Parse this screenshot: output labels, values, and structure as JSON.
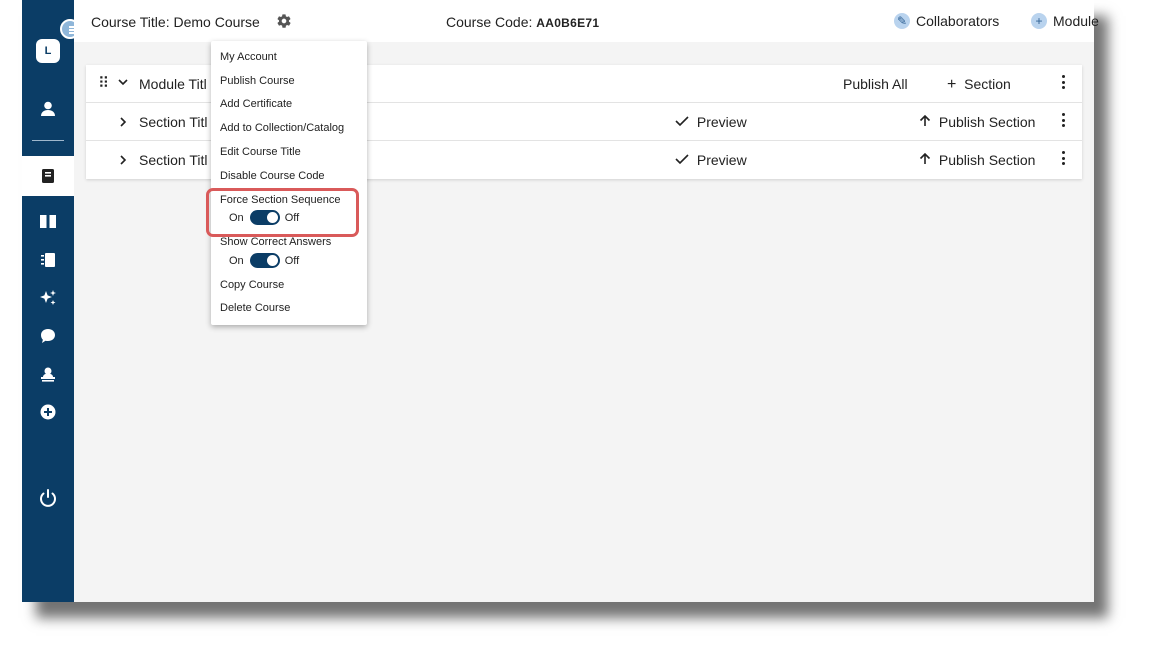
{
  "sidebar": {
    "avatar_letter": "L",
    "icons": [
      "person-icon",
      "book-icon",
      "open-book-icon",
      "notebook-icon",
      "sparkle-icon",
      "chat-icon",
      "teacher-icon",
      "add-circle-icon",
      "power-icon"
    ]
  },
  "header": {
    "course_title": "Course Title: Demo Course",
    "course_code_label": "Course Code:",
    "course_code_value": "AA0B6E71",
    "collaborators_label": "Collaborators",
    "module_label": "Module"
  },
  "module": {
    "title": "Module Titl",
    "publish_all": "Publish All",
    "add_section": "Section",
    "sections": [
      {
        "title": "Section Titl",
        "preview": "Preview",
        "publish": "Publish Section"
      },
      {
        "title": "Section Titl",
        "preview": "Preview",
        "publish": "Publish Section"
      }
    ]
  },
  "menu": {
    "my_account": "My Account",
    "publish_course": "Publish Course",
    "add_certificate": "Add Certificate",
    "add_to_collection": "Add to Collection/Catalog",
    "edit_course_title": "Edit Course Title",
    "disable_course_code": "Disable Course Code",
    "force_section_sequence": "Force Section Sequence",
    "show_correct_answers": "Show Correct Answers",
    "on": "On",
    "off": "Off",
    "copy_course": "Copy Course",
    "delete_course": "Delete Course"
  },
  "colors": {
    "sidebar": "#0b3d66",
    "highlight": "#d95a5a",
    "toggle": "#0b3d66"
  }
}
